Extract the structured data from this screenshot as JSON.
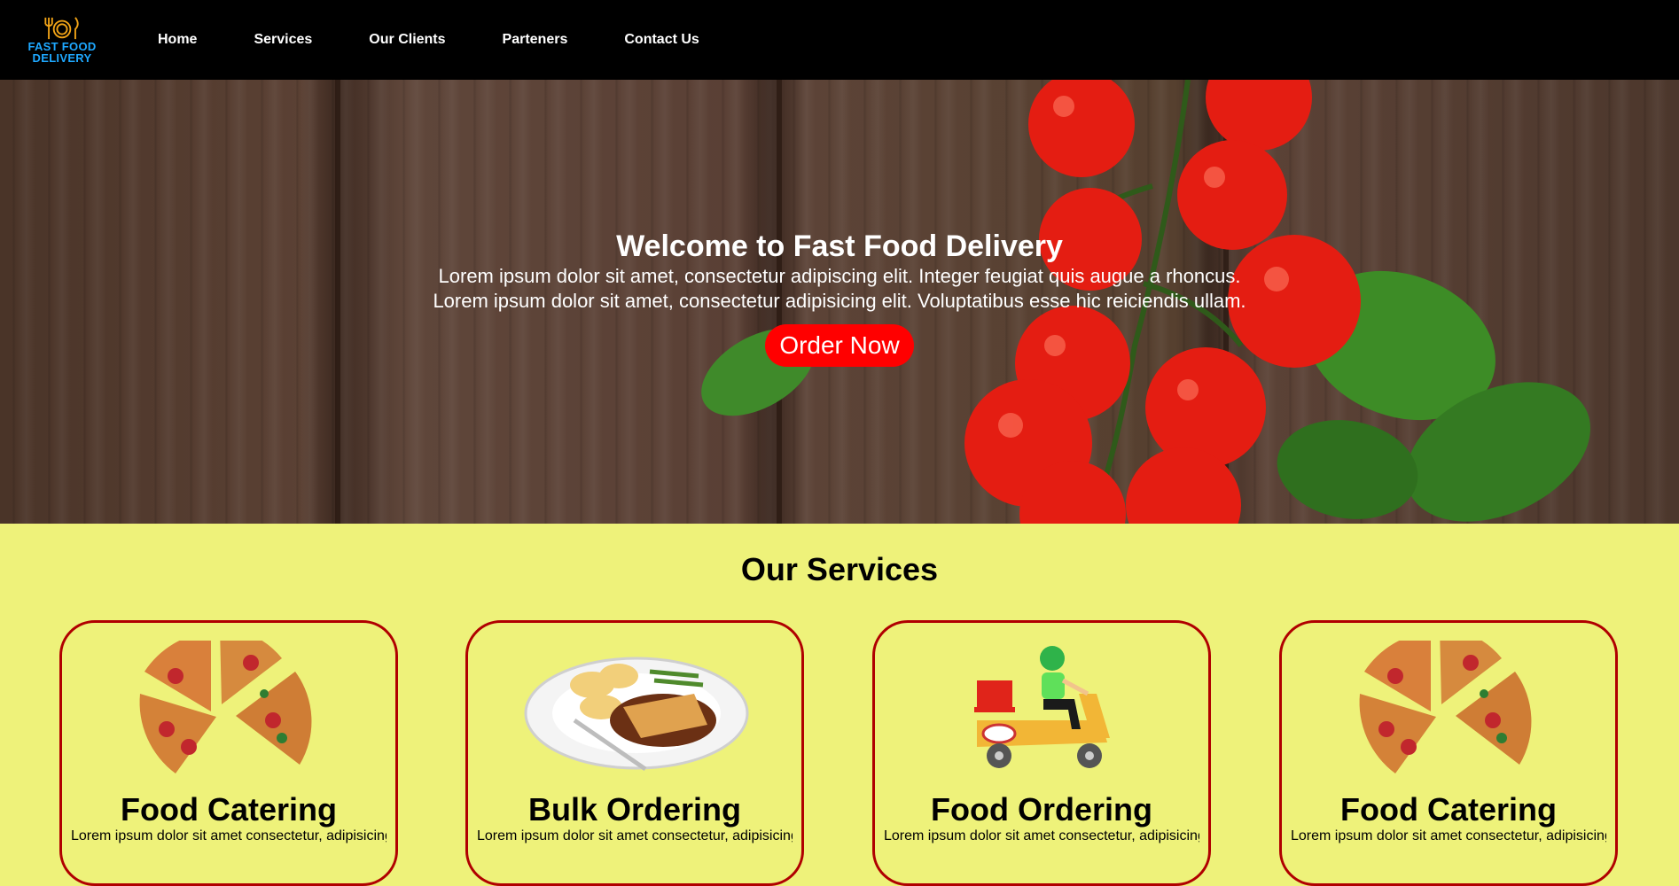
{
  "logo": {
    "line1": "FAST FOOD",
    "line2": "DELIVERY",
    "icon": "cutlery-icon"
  },
  "nav": {
    "items": [
      {
        "label": "Home"
      },
      {
        "label": "Services"
      },
      {
        "label": "Our Clients"
      },
      {
        "label": "Parteners"
      },
      {
        "label": "Contact Us"
      }
    ]
  },
  "hero": {
    "title": "Welcome to Fast Food Delivery",
    "line1": "Lorem ipsum dolor sit amet, consectetur adipiscing elit. Integer feugiat quis augue a rhoncus.",
    "line2": "Lorem ipsum dolor sit amet, consectetur adipisicing elit. Voluptatibus esse hic reiciendis ullam.",
    "button": "Order Now"
  },
  "services": {
    "title": "Our Services",
    "cards": [
      {
        "title": "Food Catering",
        "text": "Lorem ipsum dolor sit amet consectetur, adipisicing elit.",
        "image": "pizza-image"
      },
      {
        "title": "Bulk Ordering",
        "text": "Lorem ipsum dolor sit amet consectetur, adipisicing elit.",
        "image": "meal-plate-image"
      },
      {
        "title": "Food Ordering",
        "text": "Lorem ipsum dolor sit amet consectetur, adipisicing elit.",
        "image": "delivery-scooter-image"
      },
      {
        "title": "Food Catering",
        "text": "Lorem ipsum dolor sit amet consectetur, adipisicing elit.",
        "image": "pizza-image"
      }
    ]
  },
  "colors": {
    "navbar": "#000000",
    "accent": "#ff0000",
    "page_bg": "#eef27a",
    "card_border": "#b00000",
    "logo_text": "#1ea8ff"
  }
}
